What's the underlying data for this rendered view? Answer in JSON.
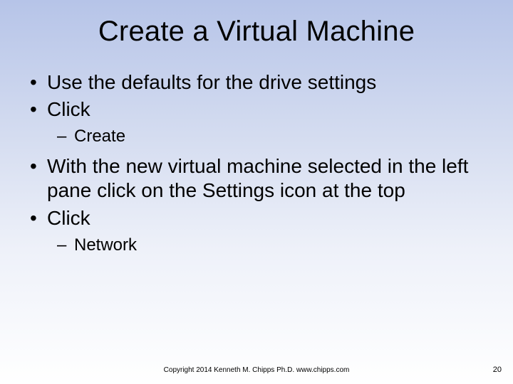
{
  "title": "Create a Virtual Machine",
  "bullets": {
    "b1": "Use the defaults for the drive settings",
    "b2": "Click",
    "b2_sub1": "Create",
    "b3": "With the new virtual machine selected in the left pane click on the Settings icon at the top",
    "b4": "Click",
    "b4_sub1": "Network"
  },
  "footer": "Copyright 2014 Kenneth M. Chipps Ph.D. www.chipps.com",
  "page_number": "20"
}
